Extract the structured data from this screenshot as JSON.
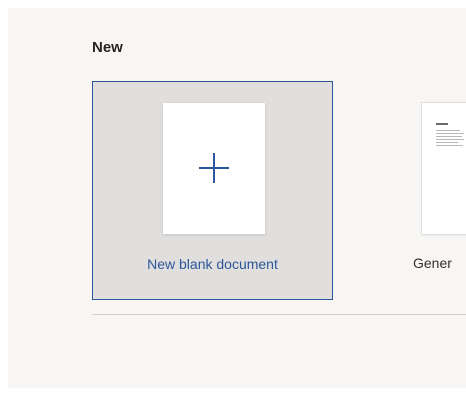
{
  "section": {
    "title": "New"
  },
  "tiles": {
    "blank": {
      "label": "New blank document",
      "icon": "plus-icon"
    },
    "template": {
      "label": "Gener"
    }
  },
  "colors": {
    "accent": "#2b579a",
    "tile_selected_bg": "#e1dfdd",
    "panel_bg": "#f7f6f5"
  }
}
